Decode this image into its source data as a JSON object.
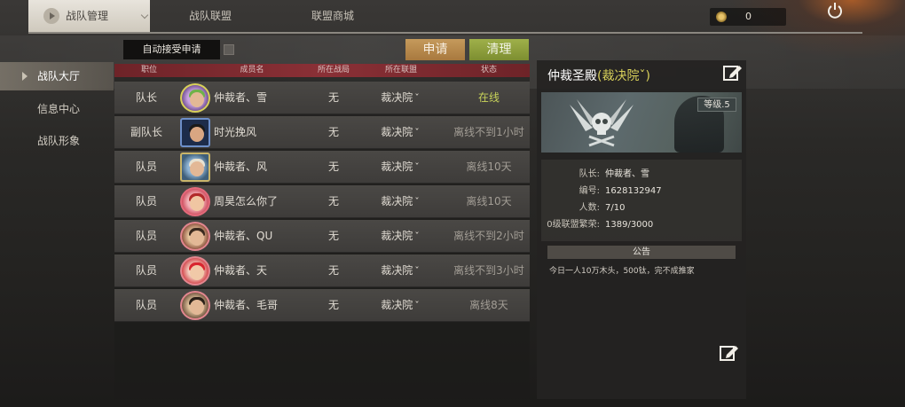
{
  "topbar": {
    "tabs": [
      {
        "label": "战队管理",
        "active": true
      },
      {
        "label": "战队联盟",
        "active": false
      },
      {
        "label": "联盟商城",
        "active": false
      }
    ],
    "coins": "0"
  },
  "sidebar": {
    "items": [
      {
        "label": "战队大厅",
        "active": true
      },
      {
        "label": "信息中心",
        "active": false
      },
      {
        "label": "战队形象",
        "active": false
      }
    ]
  },
  "actions": {
    "auto_accept_label": "自动接受申请",
    "auto_accept_checked": false,
    "apply_label": "申请",
    "clean_label": "清理"
  },
  "table": {
    "columns": [
      "职位",
      "成员名",
      "所在战局",
      "所在联盟",
      "状态"
    ],
    "rows": [
      {
        "role": "队长",
        "name": "仲裁者、雪",
        "war": "无",
        "alliance": "裁决院",
        "status": "在线",
        "online": true
      },
      {
        "role": "副队长",
        "name": "时光挽风",
        "war": "无",
        "alliance": "裁决院",
        "status": "离线不到1小时",
        "online": false
      },
      {
        "role": "队员",
        "name": "仲裁者、风",
        "war": "无",
        "alliance": "裁决院",
        "status": "离线10天",
        "online": false
      },
      {
        "role": "队员",
        "name": "周昊怎么你了",
        "war": "无",
        "alliance": "裁决院",
        "status": "离线10天",
        "online": false
      },
      {
        "role": "队员",
        "name": "仲裁者、QU",
        "war": "无",
        "alliance": "裁决院",
        "status": "离线不到2小时",
        "online": false
      },
      {
        "role": "队员",
        "name": "仲裁者、天",
        "war": "无",
        "alliance": "裁决院",
        "status": "离线不到3小时",
        "online": false
      },
      {
        "role": "队员",
        "name": "仲裁者、毛哥",
        "war": "无",
        "alliance": "裁决院",
        "status": "离线8天",
        "online": false
      }
    ]
  },
  "panel": {
    "team_name": "仲裁圣殿",
    "alliance_open": "(",
    "alliance_name": "裁决院",
    "alliance_caret": "ˇ",
    "alliance_close": ")",
    "level": "等级.5",
    "info": [
      {
        "key": "队长:",
        "value": "仲裁者、雪"
      },
      {
        "key": "编号:",
        "value": "1628132947"
      },
      {
        "key": "人数:",
        "value": "7/10"
      },
      {
        "key": "0级联盟繁荣:",
        "value": "1389/3000"
      }
    ],
    "notice_title": "公告",
    "notice_text": "今日一人10万木头，500钛，完不成推家"
  },
  "colors": {
    "online": "#c8d35a",
    "alliance_highlight": "#d8d05a",
    "header_red": "#8a3036",
    "apply_button": "#c59a5c",
    "clean_button": "#9fb04a"
  },
  "icons": [
    "play-icon",
    "coin-icon",
    "power-icon",
    "edit-icon",
    "skull-emblem-icon",
    "avatar"
  ]
}
